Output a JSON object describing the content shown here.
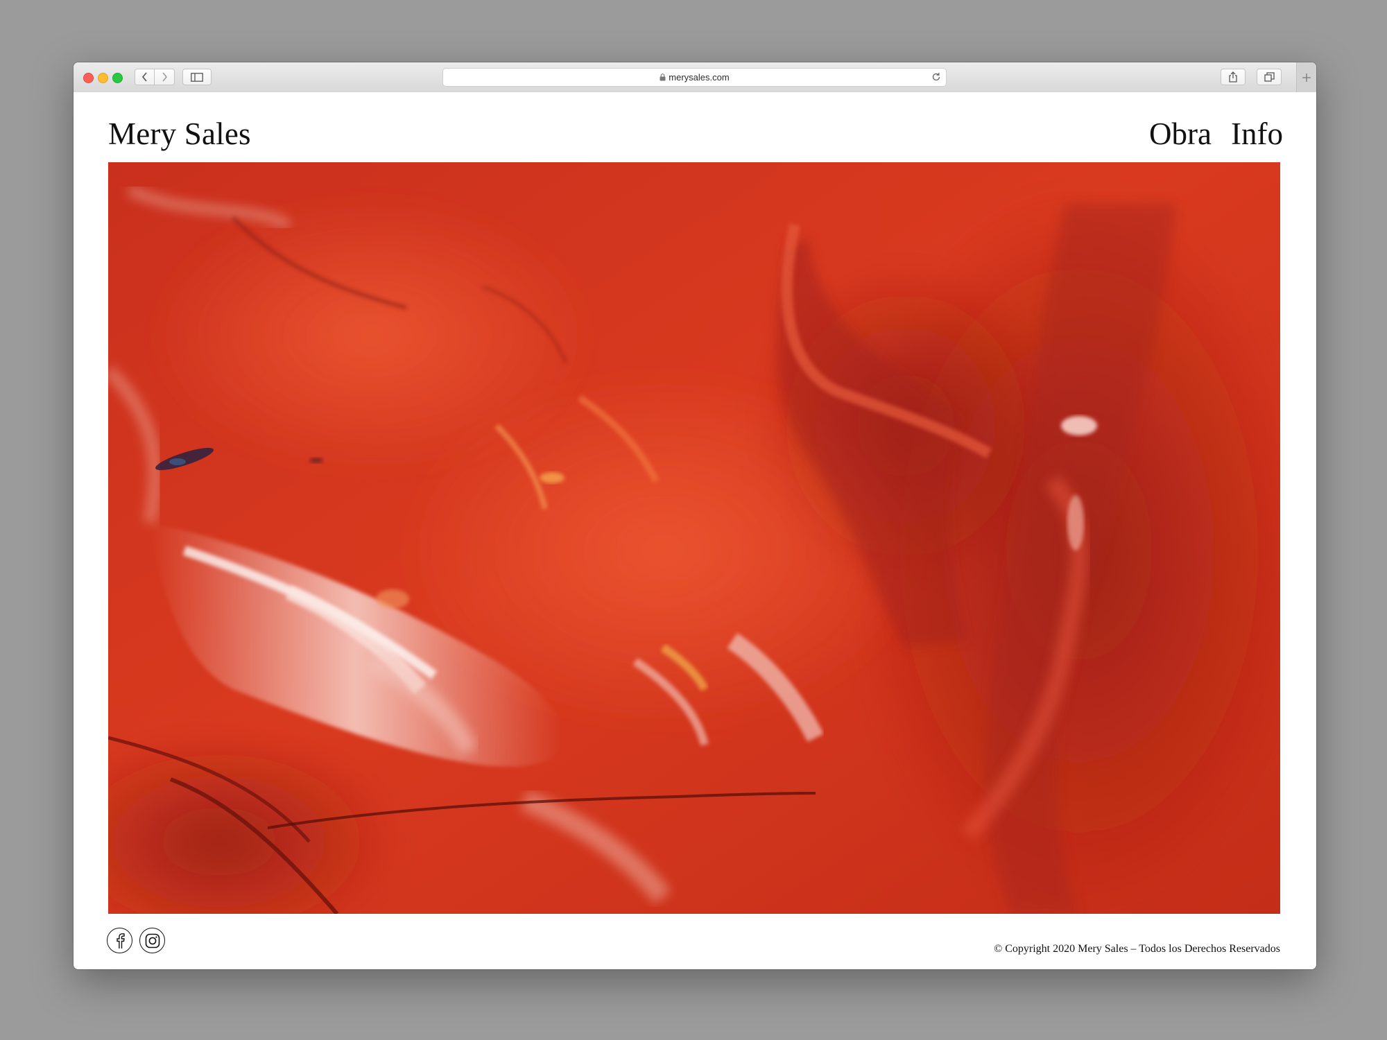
{
  "browser": {
    "url": "merysales.com"
  },
  "site": {
    "title": "Mery Sales",
    "nav": [
      {
        "label": "Obra"
      },
      {
        "label": "Info"
      }
    ],
    "copyright": "© Copyright 2020 Mery Sales – Todos los Derechos Reservados",
    "social": [
      "facebook-icon",
      "instagram-icon"
    ]
  },
  "colors": {
    "background": "#9b9b9b",
    "page": "#ffffff",
    "text": "#111111",
    "artwork_red": "#d8361e"
  }
}
